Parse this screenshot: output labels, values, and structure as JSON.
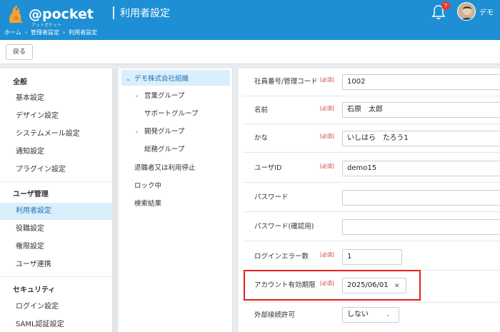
{
  "header": {
    "logo_text": "@pocket",
    "logo_sub": "アットポケット",
    "title": "利用者設定",
    "notification_count": "7",
    "user_name": "デモ"
  },
  "breadcrumb": [
    "ホーム",
    "管理者設定",
    "利用者設定"
  ],
  "toolbar": {
    "back_label": "戻る"
  },
  "sidebar": {
    "general_heading": "全般",
    "general_items": [
      "基本設定",
      "デザイン設定",
      "システムメール設定",
      "通知設定",
      "プラグイン設定"
    ],
    "user_heading": "ユーザ管理",
    "user_items": [
      "利用者設定",
      "役職設定",
      "権限設定",
      "ユーザ連携"
    ],
    "security_heading": "セキュリティ",
    "security_items": [
      "ログイン設定",
      "SAML認証設定"
    ]
  },
  "tree": {
    "root": "デモ株式会社組織",
    "groups": [
      "営業グループ",
      "サポートグループ",
      "開発グループ",
      "総務グループ"
    ],
    "extras": [
      "退職者又は利用停止",
      "ロック中",
      "検索結果"
    ]
  },
  "form": {
    "required_label": "[必須]",
    "fields": [
      {
        "label": "社員番号/管理コード",
        "required": true,
        "value": "1002"
      },
      {
        "label": "名前",
        "required": true,
        "value": "石原　太郎"
      },
      {
        "label": "かな",
        "required": true,
        "value": "いしはら　たろう1"
      },
      {
        "label": "ユーザID",
        "required": true,
        "value": "demo15"
      },
      {
        "label": "パスワード",
        "required": false,
        "value": ""
      },
      {
        "label": "パスワード(確認用)",
        "required": false,
        "value": ""
      },
      {
        "label": "ログインエラー数",
        "required": true,
        "value": "1"
      },
      {
        "label": "アカウント有効期限",
        "required": true,
        "value": "2025/06/01"
      },
      {
        "label": "外部接続許可",
        "required": false,
        "value": "しない"
      }
    ]
  },
  "colors": {
    "header": "#1e8fd4",
    "active": "#dbeefb",
    "required": "#d32f2f",
    "highlight": "#e3201b"
  }
}
